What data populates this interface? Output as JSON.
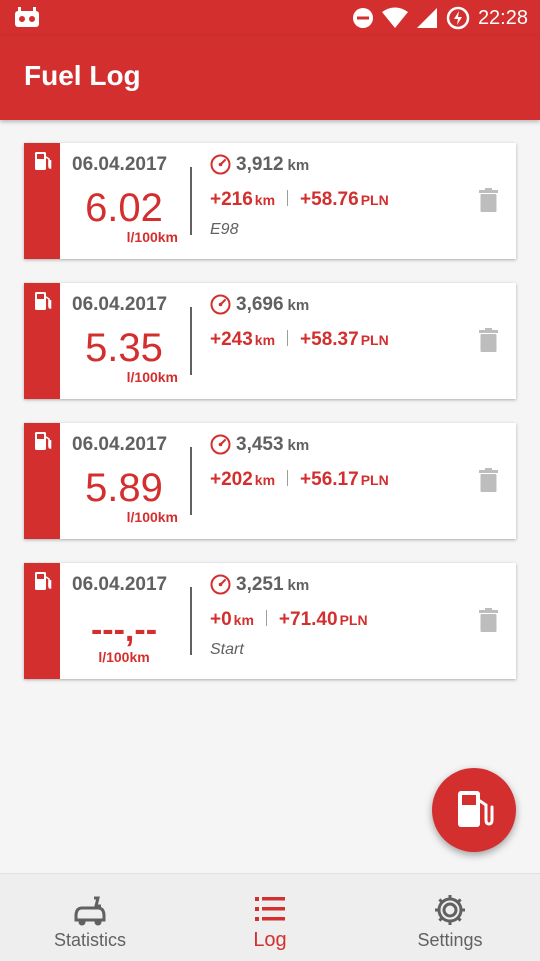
{
  "status_bar": {
    "time": "22:28"
  },
  "app_bar": {
    "title": "Fuel Log"
  },
  "entries": [
    {
      "date": "06.04.2017",
      "consumption": "6.02",
      "consumption_unit": "l/100km",
      "odometer": "3,912",
      "odometer_unit": "km",
      "distance": "+216",
      "distance_unit": "km",
      "cost": "+58.76",
      "cost_unit": "PLN",
      "note": "E98"
    },
    {
      "date": "06.04.2017",
      "consumption": "5.35",
      "consumption_unit": "l/100km",
      "odometer": "3,696",
      "odometer_unit": "km",
      "distance": "+243",
      "distance_unit": "km",
      "cost": "+58.37",
      "cost_unit": "PLN",
      "note": ""
    },
    {
      "date": "06.04.2017",
      "consumption": "5.89",
      "consumption_unit": "l/100km",
      "odometer": "3,453",
      "odometer_unit": "km",
      "distance": "+202",
      "distance_unit": "km",
      "cost": "+56.17",
      "cost_unit": "PLN",
      "note": ""
    },
    {
      "date": "06.04.2017",
      "consumption": "---,--",
      "consumption_unit": "l/100km",
      "odometer": "3,251",
      "odometer_unit": "km",
      "distance": "+0",
      "distance_unit": "km",
      "cost": "+71.40",
      "cost_unit": "PLN",
      "note": "Start"
    }
  ],
  "fab": {
    "icon": "fuel-pump-icon"
  },
  "bottom_nav": {
    "items": [
      {
        "label": "Statistics",
        "icon": "car-stats-icon",
        "active": false
      },
      {
        "label": "Log",
        "icon": "list-icon",
        "active": true
      },
      {
        "label": "Settings",
        "icon": "gear-icon",
        "active": false
      }
    ]
  },
  "colors": {
    "primary": "#d32f2f",
    "text_gray": "#616161",
    "background": "#f5f5f5",
    "nav_background": "#eeeeee"
  }
}
